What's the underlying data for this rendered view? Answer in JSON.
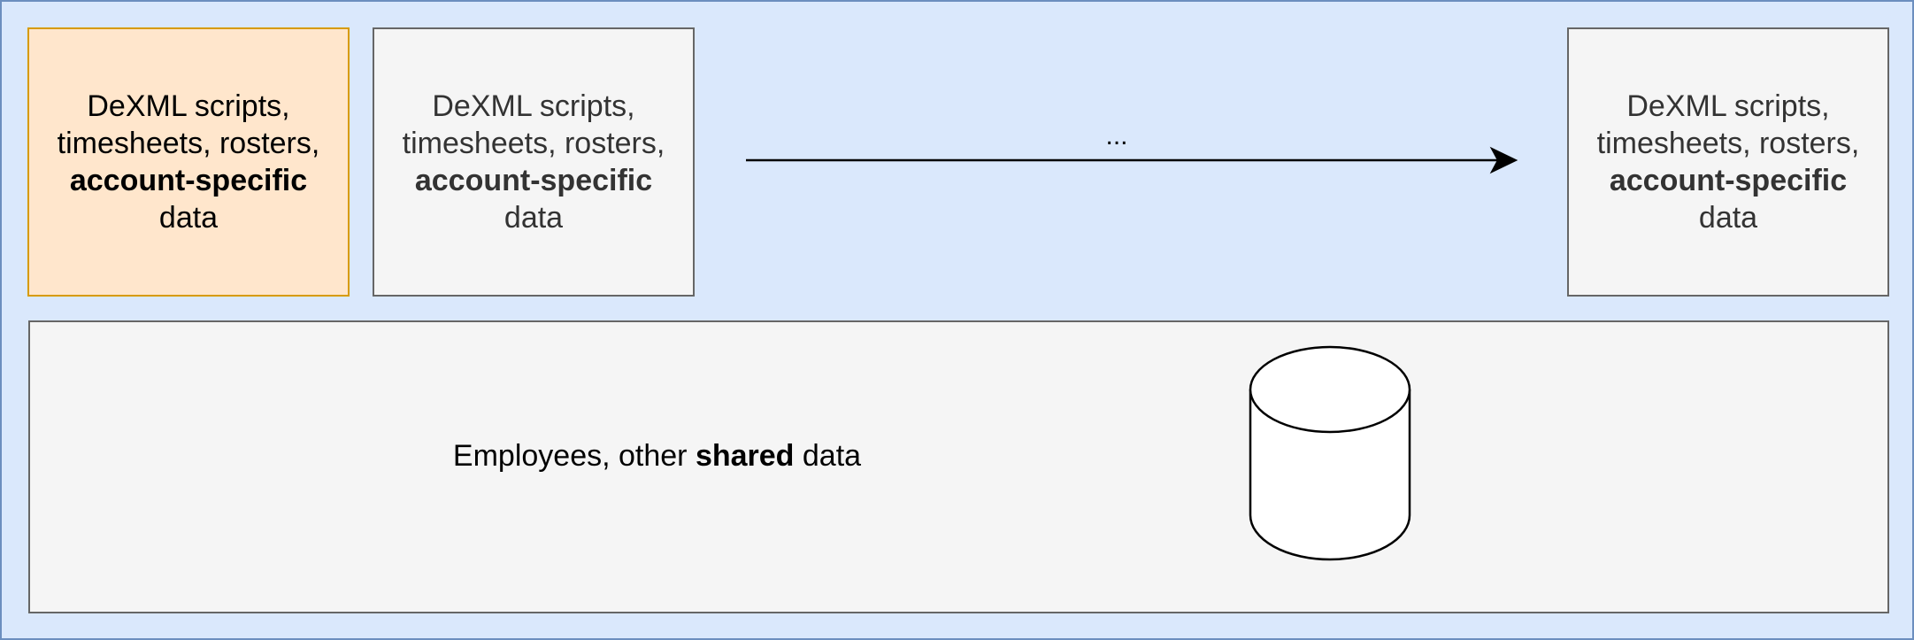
{
  "boxes": [
    {
      "line1": "DeXML scripts,",
      "line2": "timesheets, rosters,",
      "bold": "account-specific",
      "line4": "data",
      "style": "active"
    },
    {
      "line1": "DeXML scripts,",
      "line2": "timesheets, rosters,",
      "bold": "account-specific",
      "line4": "data",
      "style": "inactive"
    },
    {
      "line1": "DeXML scripts,",
      "line2": "timesheets, rosters,",
      "bold": "account-specific",
      "line4": "data",
      "style": "inactive"
    }
  ],
  "arrow_label": "...",
  "shared": {
    "prefix": "Employees, other ",
    "bold": "shared",
    "suffix": " data"
  },
  "colors": {
    "background": "#dae8fc",
    "background_border": "#6c8ebf",
    "active_fill": "#ffe6cc",
    "active_border": "#d79b00",
    "inactive_fill": "#f5f5f5",
    "inactive_border": "#666666"
  },
  "icons": {
    "database": "database-cylinder-icon",
    "arrow": "arrow-right-icon"
  }
}
